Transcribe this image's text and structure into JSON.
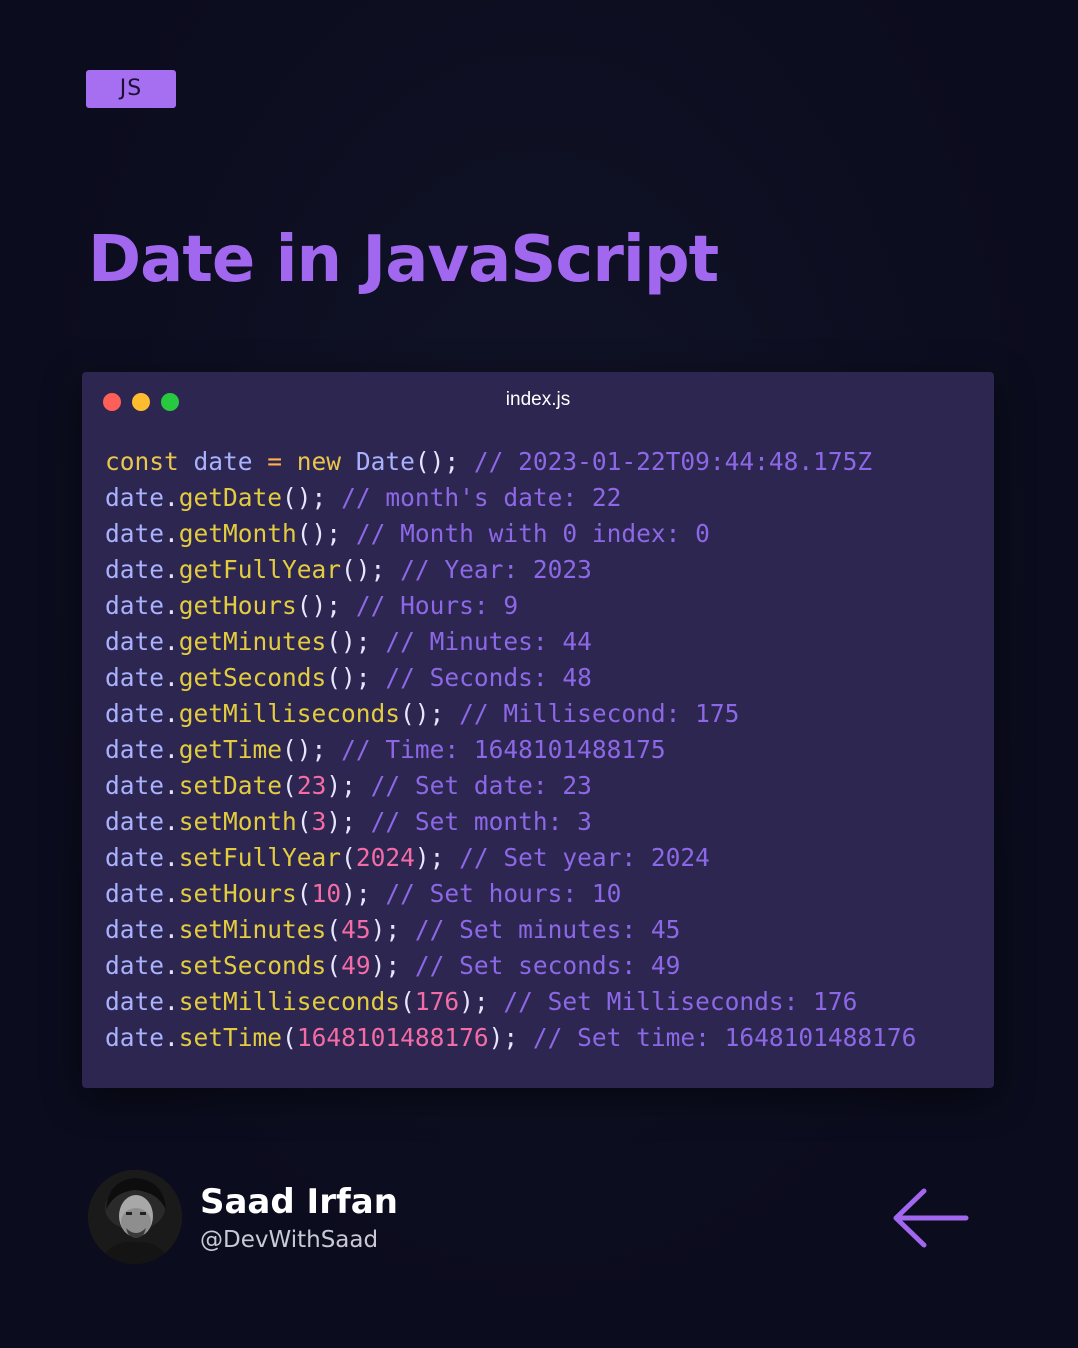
{
  "tag": {
    "label": "JS"
  },
  "title": "Date in JavaScript",
  "window": {
    "filename": "index.js",
    "controls": [
      "close-dot",
      "minimize-dot",
      "maximize-dot"
    ]
  },
  "code_lines": [
    [
      [
        "kw",
        "const"
      ],
      [
        "",
        ""
      ],
      [
        "id",
        " date "
      ],
      [
        "op",
        "="
      ],
      [
        "kw",
        " new"
      ],
      [
        "id",
        " Date"
      ],
      [
        "punc",
        "();"
      ],
      [
        "cm",
        " // 2023-01-22T09:44:48.175Z"
      ]
    ],
    [
      [
        "id",
        "date"
      ],
      [
        "punc",
        "."
      ],
      [
        "fn",
        "getDate"
      ],
      [
        "punc",
        "();"
      ],
      [
        "cm",
        " // month's date: 22"
      ]
    ],
    [
      [
        "id",
        "date"
      ],
      [
        "punc",
        "."
      ],
      [
        "fn",
        "getMonth"
      ],
      [
        "punc",
        "();"
      ],
      [
        "cm",
        " // Month with 0 index: 0"
      ]
    ],
    [
      [
        "id",
        "date"
      ],
      [
        "punc",
        "."
      ],
      [
        "fn",
        "getFullYear"
      ],
      [
        "punc",
        "();"
      ],
      [
        "cm",
        " // Year: 2023"
      ]
    ],
    [
      [
        "id",
        "date"
      ],
      [
        "punc",
        "."
      ],
      [
        "fn",
        "getHours"
      ],
      [
        "punc",
        "();"
      ],
      [
        "cm",
        " // Hours: 9"
      ]
    ],
    [
      [
        "id",
        "date"
      ],
      [
        "punc",
        "."
      ],
      [
        "fn",
        "getMinutes"
      ],
      [
        "punc",
        "();"
      ],
      [
        "cm",
        " // Minutes: 44"
      ]
    ],
    [
      [
        "id",
        "date"
      ],
      [
        "punc",
        "."
      ],
      [
        "fn",
        "getSeconds"
      ],
      [
        "punc",
        "();"
      ],
      [
        "cm",
        " // Seconds: 48"
      ]
    ],
    [
      [
        "id",
        "date"
      ],
      [
        "punc",
        "."
      ],
      [
        "fn",
        "getMilliseconds"
      ],
      [
        "punc",
        "();"
      ],
      [
        "cm",
        " // Millisecond: 175"
      ]
    ],
    [
      [
        "id",
        "date"
      ],
      [
        "punc",
        "."
      ],
      [
        "fn",
        "getTime"
      ],
      [
        "punc",
        "();"
      ],
      [
        "cm",
        " // Time: 1648101488175"
      ]
    ],
    [
      [
        "id",
        "date"
      ],
      [
        "punc",
        "."
      ],
      [
        "fn",
        "setDate"
      ],
      [
        "punc",
        "("
      ],
      [
        "num",
        "23"
      ],
      [
        "punc",
        ");"
      ],
      [
        "cm",
        " // Set date: 23"
      ]
    ],
    [
      [
        "id",
        "date"
      ],
      [
        "punc",
        "."
      ],
      [
        "fn",
        "setMonth"
      ],
      [
        "punc",
        "("
      ],
      [
        "num",
        "3"
      ],
      [
        "punc",
        ");"
      ],
      [
        "cm",
        " // Set month: 3"
      ]
    ],
    [
      [
        "id",
        "date"
      ],
      [
        "punc",
        "."
      ],
      [
        "fn",
        "setFullYear"
      ],
      [
        "punc",
        "("
      ],
      [
        "num",
        "2024"
      ],
      [
        "punc",
        ");"
      ],
      [
        "cm",
        " // Set year: 2024"
      ]
    ],
    [
      [
        "id",
        "date"
      ],
      [
        "punc",
        "."
      ],
      [
        "fn",
        "setHours"
      ],
      [
        "punc",
        "("
      ],
      [
        "num",
        "10"
      ],
      [
        "punc",
        ");"
      ],
      [
        "cm",
        " // Set hours: 10"
      ]
    ],
    [
      [
        "id",
        "date"
      ],
      [
        "punc",
        "."
      ],
      [
        "fn",
        "setMinutes"
      ],
      [
        "punc",
        "("
      ],
      [
        "num",
        "45"
      ],
      [
        "punc",
        ");"
      ],
      [
        "cm",
        " // Set minutes: 45"
      ]
    ],
    [
      [
        "id",
        "date"
      ],
      [
        "punc",
        "."
      ],
      [
        "fn",
        "setSeconds"
      ],
      [
        "punc",
        "("
      ],
      [
        "num",
        "49"
      ],
      [
        "punc",
        ");"
      ],
      [
        "cm",
        " // Set seconds: 49"
      ]
    ],
    [
      [
        "id",
        "date"
      ],
      [
        "punc",
        "."
      ],
      [
        "fn",
        "setMilliseconds"
      ],
      [
        "punc",
        "("
      ],
      [
        "num",
        "176"
      ],
      [
        "punc",
        ");"
      ],
      [
        "cm",
        " // Set Milliseconds: 176"
      ]
    ],
    [
      [
        "id",
        "date"
      ],
      [
        "punc",
        "."
      ],
      [
        "fn",
        "setTime"
      ],
      [
        "punc",
        "("
      ],
      [
        "num",
        "1648101488176"
      ],
      [
        "punc",
        ");"
      ],
      [
        "cm",
        " // Set time: 1648101488176"
      ]
    ]
  ],
  "author": {
    "name": "Saad Irfan",
    "handle": "@DevWithSaad"
  },
  "icons": {
    "back": "arrow-left-icon"
  },
  "colors": {
    "background": "#0b0c1d",
    "accent": "#a167ee",
    "tag_bg": "#a66ef0",
    "window_bg": "#2c2650",
    "keyword": "#e9c64e",
    "identifier": "#aab2ff",
    "function": "#e3cc3f",
    "number": "#f46ca5",
    "comment": "#8d68e6",
    "operator": "#ffb04f"
  }
}
